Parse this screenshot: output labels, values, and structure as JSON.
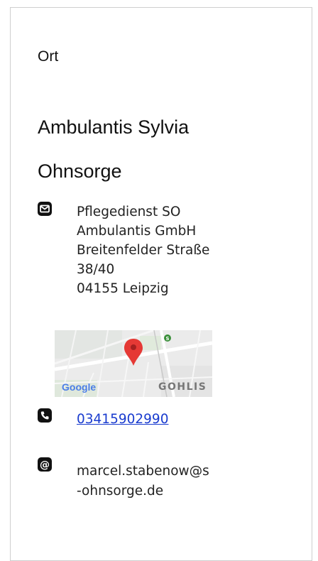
{
  "section_label": "Ort",
  "title_line1": "Ambulantis Sylvia",
  "title_line2": "Ohnsorge",
  "address": {
    "line1": "Pflegedienst SO",
    "line2": "Ambulantis GmbH",
    "line3": "Breitenfelder Straße",
    "line4": "38/40",
    "line5": "04155 Leipzig"
  },
  "map": {
    "google_text": "Google",
    "district_text": "GOHLIS",
    "marker_color": "#e53935"
  },
  "phone": "03415902990",
  "email": {
    "line1": "marcel.stabenow@s",
    "line2": "-ohnsorge.de"
  },
  "icons": {
    "mail": "envelope-icon",
    "phone": "phone-icon",
    "email": "at-sign-icon"
  }
}
